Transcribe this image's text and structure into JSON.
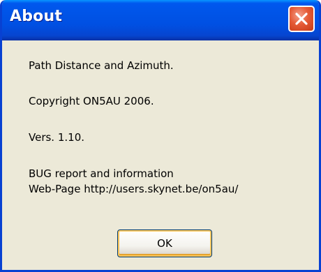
{
  "window": {
    "title": "About",
    "close_icon": "close-icon",
    "colors": {
      "titlebar": "#0053e6",
      "body": "#ece9d8",
      "close_button": "#e55a36"
    }
  },
  "content": {
    "app_name": "Path Distance and Azimuth.",
    "copyright": "Copyright ON5AU 2006.",
    "version": "Vers. 1.10.",
    "bug_report": "BUG report and information",
    "web_page": "Web-Page http://users.skynet.be/on5au/"
  },
  "buttons": {
    "ok_label": "OK"
  }
}
